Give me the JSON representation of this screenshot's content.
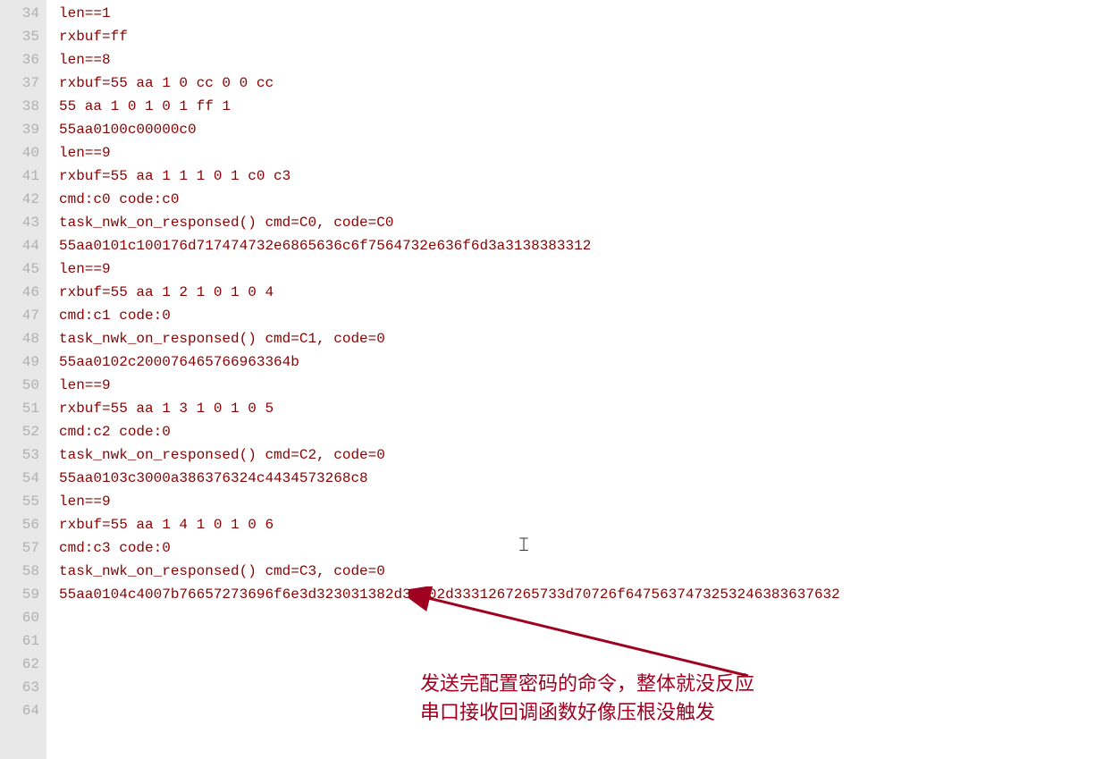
{
  "editor": {
    "startLine": 34,
    "endLine": 64,
    "lines": [
      "len==1",
      "rxbuf=ff",
      "len==8",
      "rxbuf=55 aa 1 0 cc 0 0 cc",
      "55 aa 1 0 1 0 1 ff 1",
      "55aa0100c00000c0",
      "len==9",
      "rxbuf=55 aa 1 1 1 0 1 c0 c3",
      "cmd:c0 code:c0",
      "task_nwk_on_responsed() cmd=C0, code=C0",
      "55aa0101c100176d717474732e6865636c6f7564732e636f6d3a3138383312",
      "len==9",
      "rxbuf=55 aa 1 2 1 0 1 0 4",
      "cmd:c1 code:0",
      "task_nwk_on_responsed() cmd=C1, code=0",
      "55aa0102c200076465766963364b",
      "len==9",
      "rxbuf=55 aa 1 3 1 0 1 0 5",
      "cmd:c2 code:0",
      "task_nwk_on_responsed() cmd=C2, code=0",
      "55aa0103c3000a386376324c4434573268c8",
      "len==9",
      "rxbuf=55 aa 1 4 1 0 1 0 6",
      "cmd:c3 code:0",
      "task_nwk_on_responsed() cmd=C3, code=0",
      "55aa0104c4007b76657273696f6e3d323031382d31302d3331267265733d70726f6475637473253246383637632",
      "",
      "",
      "",
      "",
      ""
    ]
  },
  "annotation": {
    "line1": "发送完配置密码的命令，整体就没反应",
    "line2": "串口接收回调函数好像压根没触发"
  },
  "cursorGlyph": "𝙸"
}
